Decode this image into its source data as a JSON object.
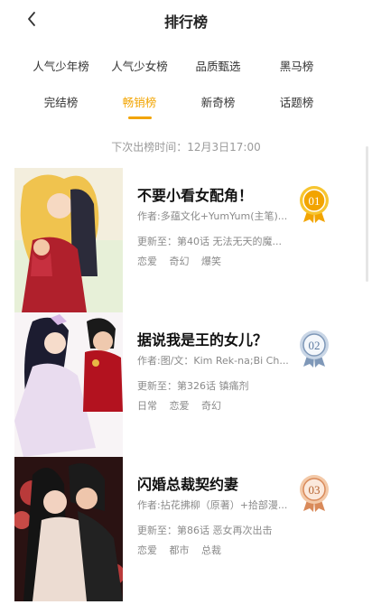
{
  "header": {
    "title": "排行榜"
  },
  "tabs_row1": [
    {
      "label": "人气少年榜"
    },
    {
      "label": "人气少女榜"
    },
    {
      "label": "品质甄选"
    },
    {
      "label": "黑马榜"
    }
  ],
  "tabs_row2": [
    {
      "label": "完结榜"
    },
    {
      "label": "畅销榜",
      "active": true
    },
    {
      "label": "新奇榜"
    },
    {
      "label": "话题榜"
    }
  ],
  "next_release": "下次出榜时间：12月3日17:00",
  "items": [
    {
      "rank": "01",
      "name": "不要小看女配角！",
      "author": "作者:多蕴文化+YumYum(主笔)...",
      "update": "更新至：第40话 无法无天的魔...",
      "tags": [
        "恋爱",
        "奇幻",
        "爆笑"
      ],
      "medal_color": "#f2a400"
    },
    {
      "rank": "02",
      "name": "据说我是王的女儿？",
      "author": "作者:图/文：Kim Rek-na;Bi Ch...",
      "update": "更新至：第326话 镇痛剂",
      "tags": [
        "日常",
        "恋爱",
        "奇幻"
      ],
      "medal_color": "#7f98b8"
    },
    {
      "rank": "03",
      "name": "闪婚总裁契约妻",
      "author": "作者:拈花拂柳（原著）+拾部漫...",
      "update": "更新至：第86话 恶女再次出击",
      "tags": [
        "恋爱",
        "都市",
        "总裁"
      ],
      "medal_color": "#d98a5a"
    }
  ]
}
